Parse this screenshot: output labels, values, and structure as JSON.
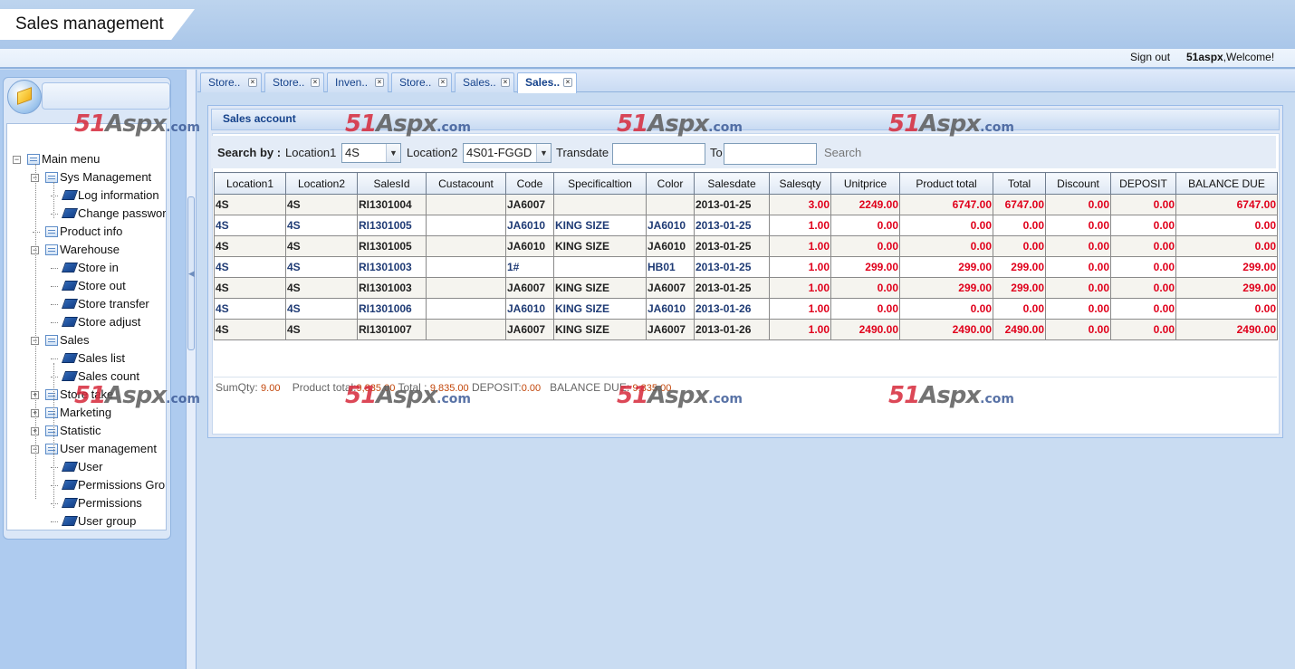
{
  "header": {
    "app_title": "Sales management",
    "sign_out": "Sign out",
    "username": "51aspx",
    "welcome": ",Welcome!"
  },
  "sidebar": {
    "tree": [
      {
        "label": "Main menu",
        "level": 0,
        "type": "folder",
        "toggle": "−"
      },
      {
        "label": "Sys Management",
        "level": 1,
        "type": "folder",
        "toggle": "−"
      },
      {
        "label": "Log information",
        "level": 2,
        "type": "leaf"
      },
      {
        "label": "Change password",
        "level": 2,
        "type": "leaf"
      },
      {
        "label": "Product info",
        "level": 1,
        "type": "folder",
        "toggle": ""
      },
      {
        "label": "Warehouse",
        "level": 1,
        "type": "folder",
        "toggle": "−"
      },
      {
        "label": "Store in",
        "level": 2,
        "type": "leaf"
      },
      {
        "label": "Store out",
        "level": 2,
        "type": "leaf"
      },
      {
        "label": "Store transfer",
        "level": 2,
        "type": "leaf"
      },
      {
        "label": "Store adjust",
        "level": 2,
        "type": "leaf"
      },
      {
        "label": "Sales",
        "level": 1,
        "type": "folder",
        "toggle": "−"
      },
      {
        "label": "Sales list",
        "level": 2,
        "type": "leaf"
      },
      {
        "label": "Sales count",
        "level": 2,
        "type": "leaf"
      },
      {
        "label": "Store take",
        "level": 1,
        "type": "folder",
        "toggle": "+"
      },
      {
        "label": "Marketing",
        "level": 1,
        "type": "folder",
        "toggle": "+"
      },
      {
        "label": "Statistic",
        "level": 1,
        "type": "folder",
        "toggle": "+"
      },
      {
        "label": "User management",
        "level": 1,
        "type": "folder",
        "toggle": "−"
      },
      {
        "label": "User",
        "level": 2,
        "type": "leaf"
      },
      {
        "label": "Permissions Group",
        "level": 2,
        "type": "leaf"
      },
      {
        "label": "Permissions",
        "level": 2,
        "type": "leaf"
      },
      {
        "label": "User group",
        "level": 2,
        "type": "leaf"
      }
    ]
  },
  "tabs": [
    {
      "label": "Store..",
      "active": false
    },
    {
      "label": "Store..",
      "active": false
    },
    {
      "label": "Inven..",
      "active": false
    },
    {
      "label": "Store..",
      "active": false
    },
    {
      "label": "Sales..",
      "active": false
    },
    {
      "label": "Sales..",
      "active": true
    }
  ],
  "panel": {
    "title": "Sales account"
  },
  "search": {
    "search_by": "Search by :",
    "location1_label": "Location1",
    "location1_value": "4S",
    "location2_label": "Location2",
    "location2_value": "4S01-FGGD",
    "transdate_label": "Transdate",
    "transdate_value": "",
    "to_label": "To",
    "to_value": "",
    "search_button": "Search"
  },
  "grid": {
    "columns": [
      "Location1",
      "Location2",
      "SalesId",
      "Custacount",
      "Code",
      "Specificaltion",
      "Color",
      "Salesdate",
      "Salesqty",
      "Unitprice",
      "Product total",
      "Total",
      "Discount",
      "DEPOSIT",
      "BALANCE DUE"
    ],
    "rows": [
      [
        "4S",
        "4S",
        "RI1301004",
        "",
        "JA6007",
        "",
        "",
        "2013-01-25",
        "3.00",
        "2249.00",
        "6747.00",
        "6747.00",
        "0.00",
        "0.00",
        "6747.00"
      ],
      [
        "4S",
        "4S",
        "RI1301005",
        "",
        "JA6010",
        "KING SIZE",
        "JA6010",
        "2013-01-25",
        "1.00",
        "0.00",
        "0.00",
        "0.00",
        "0.00",
        "0.00",
        "0.00"
      ],
      [
        "4S",
        "4S",
        "RI1301005",
        "",
        "JA6010",
        "KING SIZE",
        "JA6010",
        "2013-01-25",
        "1.00",
        "0.00",
        "0.00",
        "0.00",
        "0.00",
        "0.00",
        "0.00"
      ],
      [
        "4S",
        "4S",
        "RI1301003",
        "",
        "1#",
        "",
        "HB01",
        "2013-01-25",
        "1.00",
        "299.00",
        "299.00",
        "299.00",
        "0.00",
        "0.00",
        "299.00"
      ],
      [
        "4S",
        "4S",
        "RI1301003",
        "",
        "JA6007",
        "KING SIZE",
        "JA6007",
        "2013-01-25",
        "1.00",
        "0.00",
        "299.00",
        "299.00",
        "0.00",
        "0.00",
        "299.00"
      ],
      [
        "4S",
        "4S",
        "RI1301006",
        "",
        "JA6010",
        "KING SIZE",
        "JA6010",
        "2013-01-26",
        "1.00",
        "0.00",
        "0.00",
        "0.00",
        "0.00",
        "0.00",
        "0.00"
      ],
      [
        "4S",
        "4S",
        "RI1301007",
        "",
        "JA6007",
        "KING SIZE",
        "JA6007",
        "2013-01-26",
        "1.00",
        "2490.00",
        "2490.00",
        "2490.00",
        "0.00",
        "0.00",
        "2490.00"
      ]
    ]
  },
  "summary": {
    "sumqty_label": "SumQty:",
    "sumqty": "9.00",
    "product_total_label": "Product total:",
    "product_total": "9,835.00",
    "total_label": "Total :",
    "total": "9,835.00",
    "deposit_label": "DEPOSIT:",
    "deposit": "0.00",
    "balance_label": "BALANCE DUE:",
    "balance": "9,835.00"
  },
  "watermark": {
    "brand": "51",
    "brand_a": "Aspx",
    "brand_com": ".com"
  },
  "colors": {
    "accent": "#15428b",
    "number": "#e0001b",
    "background": "#c9dcf2"
  }
}
